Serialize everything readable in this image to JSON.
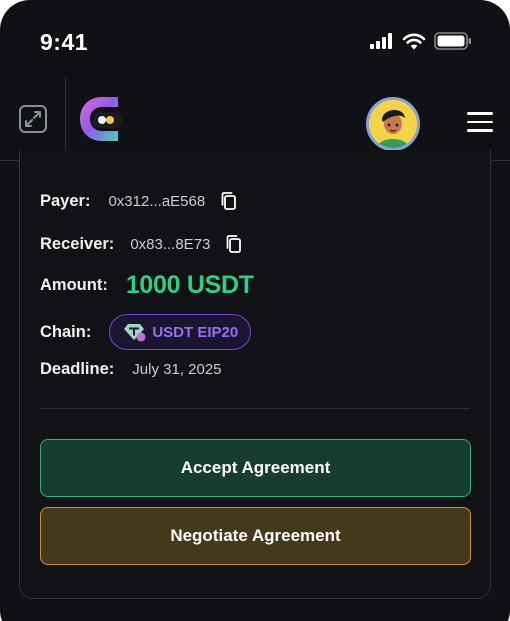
{
  "status_bar": {
    "time": "9:41"
  },
  "header": {
    "logo_alt": "app-logo"
  },
  "agreement": {
    "payer_label": "Payer:",
    "payer_value": "0x312...aE568",
    "receiver_label": "Receiver:",
    "receiver_value": "0x83...8E73",
    "amount_label": "Amount:",
    "amount_value": "1000 USDT",
    "chain_label": "Chain:",
    "chain_value": "USDT EIP20",
    "deadline_label": "Deadline:",
    "deadline_value": "July 31, 2025"
  },
  "actions": {
    "accept_label": "Accept Agreement",
    "negotiate_label": "Negotiate Agreement"
  },
  "colors": {
    "background": "#0f1114",
    "amount_green": "#2ecf84",
    "chain_purple": "#9d6cf0",
    "accept_border": "#36b07e",
    "negotiate_border": "#c8962e"
  },
  "icons": {
    "copy": "copy-icon",
    "expand": "expand-icon",
    "menu": "hamburger-menu-icon",
    "signal": "cellular-signal-icon",
    "wifi": "wifi-icon",
    "battery": "battery-icon",
    "token": "tether-token-icon"
  }
}
